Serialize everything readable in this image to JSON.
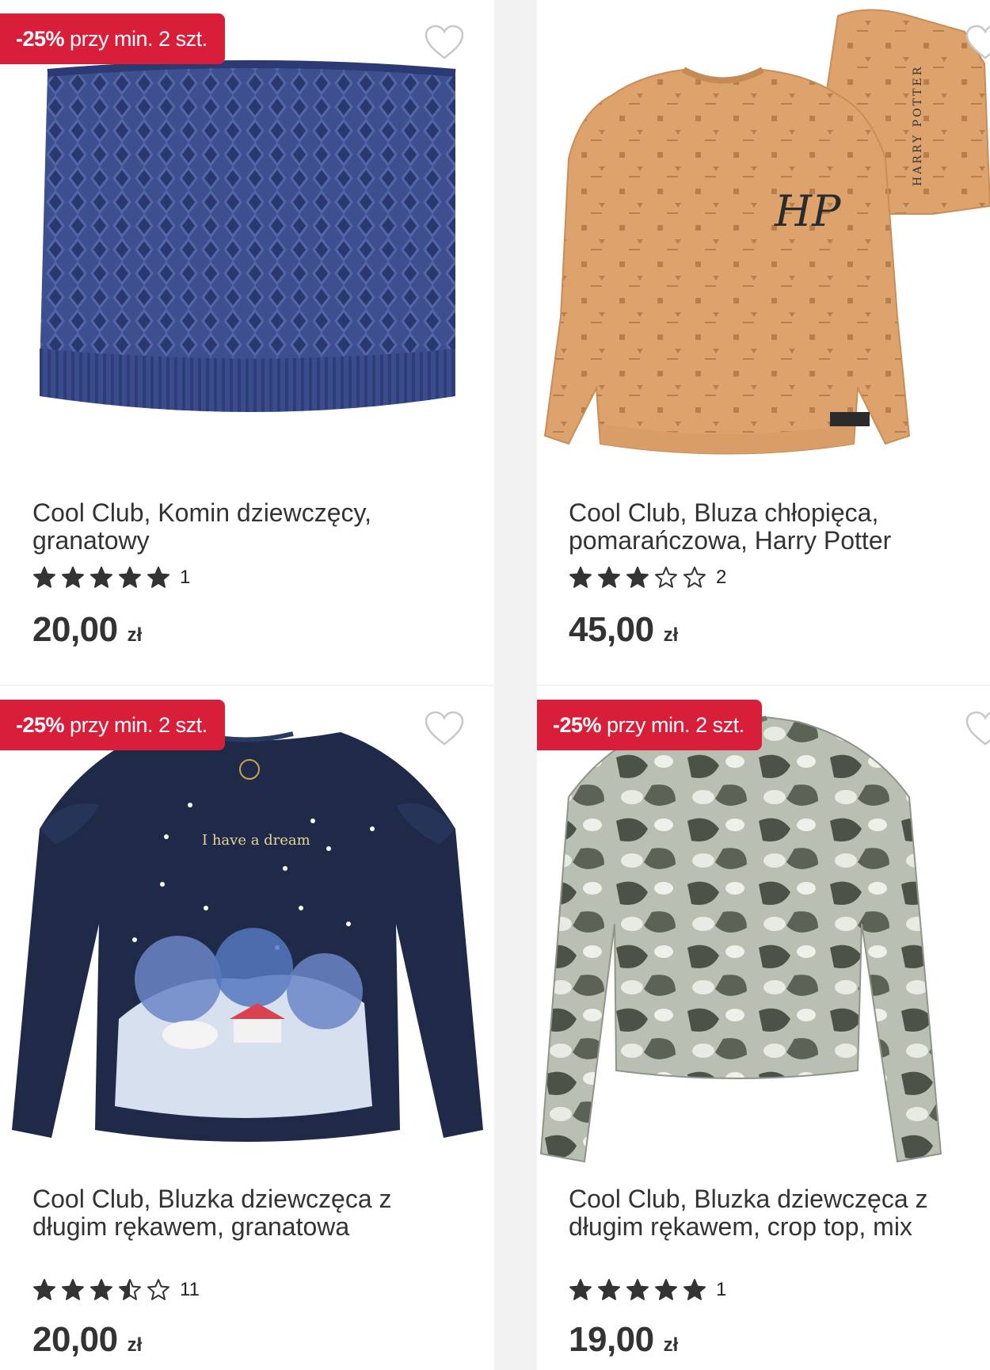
{
  "products": [
    {
      "badge_pct": "-25%",
      "badge_text": "przy min. 2 szt.",
      "title": "Cool Club, Komin dziewczęcy, granatowy",
      "rating": 5,
      "reviews": "1",
      "price": "20,00",
      "currency": "zł",
      "image_icon": "knit-neck-warmer-image"
    },
    {
      "title": "Cool Club, Bluza chłopięca, pomarańczowa, Harry Potter",
      "rating": 3,
      "reviews": "2",
      "price": "45,00",
      "currency": "zł",
      "image_icon": "harry-potter-sweatshirt-image",
      "print_text": "HARRY POTTER",
      "logo_text": "HP"
    },
    {
      "badge_pct": "-25%",
      "badge_text": "przy min. 2 szt.",
      "title": "Cool Club, Bluzka dziewczęca z długim rękawem, granatowa",
      "rating": 3.5,
      "reviews": "11",
      "price": "20,00",
      "currency": "zł",
      "image_icon": "navy-long-sleeve-top-image",
      "print_text": "I have a dream"
    },
    {
      "badge_pct": "-25%",
      "badge_text": "przy min. 2 szt.",
      "title": "Cool Club, Bluzka dziewczęca z długim rękawem, crop top, mix",
      "rating": 5,
      "reviews": "1",
      "price": "19,00",
      "currency": "zł",
      "image_icon": "tie-dye-crop-top-image"
    }
  ],
  "colors": {
    "badge": "#d91e3a",
    "star": "#333333",
    "text": "#333333"
  }
}
